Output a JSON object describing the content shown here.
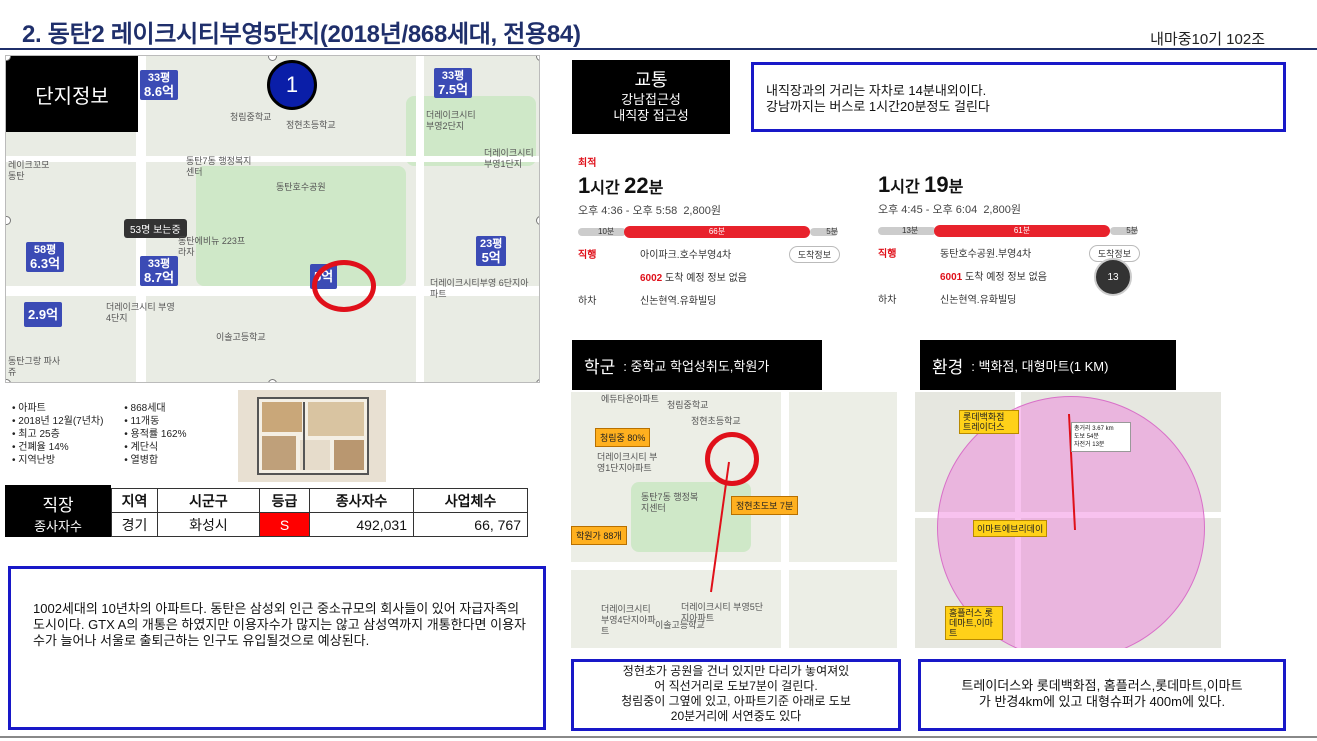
{
  "title": "2. 동탄2 레이크시티부영5단지(2018년/868세대, 전용84)",
  "subtitle": "내마중10기 102조",
  "map": {
    "label": "단지정보",
    "marker_number": "1",
    "viewing_badge": "53명 보는중",
    "prices": [
      {
        "top": "33평",
        "value": "8.6억"
      },
      {
        "top": "33평",
        "value": "7.5억"
      },
      {
        "top": "58평",
        "value": "6.3억"
      },
      {
        "top": "33평",
        "value": "8.7억"
      },
      {
        "top": "23평",
        "value": "5억"
      },
      {
        "top": "",
        "value": "2.9억"
      },
      {
        "top": "",
        "value": "5억"
      }
    ],
    "places": [
      "청림중학교",
      "정현초등학교",
      "동탄7동 행정복지센터",
      "동탄호수공원",
      "더레이크시티 부영2단지",
      "더레이크시티 부영1단지",
      "동탄에비뉴 223프라자",
      "더레이크시티부영 6단지아파트",
      "더레이크시티 부영4단지",
      "이솔고등학교",
      "레이크꼬모 동탄",
      "동탄그랑 파사쥬"
    ]
  },
  "apt_info": {
    "left": [
      "아파트",
      "2018년 12월(7년차)",
      "최고 25층",
      "건폐율 14%",
      "지역난방"
    ],
    "right": [
      "868세대",
      "11개동",
      "용적률 162%",
      "계단식",
      "열병합"
    ]
  },
  "jobs": {
    "label_main": "직장",
    "label_sub": "종사자수",
    "headers": [
      "지역",
      "시군구",
      "등급",
      "종사자수",
      "사업체수"
    ],
    "row": [
      "경기",
      "화성시",
      "S",
      "492,031",
      "66, 767"
    ]
  },
  "summary": "1002세대의 10년차의 아파트다. 동탄은 삼성외 인근 중소규모의 회사들이 있어 자급자족의 도시이다. GTX A의 개통은 하였지만 이용자수가 많지는 않고 삼성역까지 개통한다면 이용자수가 늘어나 서울로 출퇴근하는 인구도 유입될것으로 예상된다.",
  "transport": {
    "label_main": "교통",
    "label_sub1": "강남접근성",
    "label_sub2": "내직장 접근성",
    "text_line1": "내직장과의 거리는 자차로 14분내외이다.",
    "text_line2": "강남까지는 버스로 1시간20분정도 걸린다",
    "routes": [
      {
        "best": "최적",
        "hours": "1",
        "hour_unit": "시간",
        "minutes": "22",
        "minute_unit": "분",
        "times": "오후 4:36 - 오후 5:58",
        "fare": "2,800원",
        "walk1": "10분",
        "ride": "66분",
        "walk2": "5분",
        "board_label": "직행",
        "board_stop": "아이파크.호수부영4차",
        "stop_info": "도착정보",
        "bus_no": "6002",
        "bus_status": "도착 예정 정보 없음",
        "alight_label": "하차",
        "alight_stop": "신논현역.유화빌딩"
      },
      {
        "best": "",
        "hours": "1",
        "hour_unit": "시간",
        "minutes": "19",
        "minute_unit": "분",
        "times": "오후 4:45 - 오후 6:04",
        "fare": "2,800원",
        "walk1": "13분",
        "ride": "61분",
        "walk2": "5분",
        "board_label": "직행",
        "board_stop": "동탄호수공원.부영4차",
        "stop_info": "도착정보",
        "bus_no": "6001",
        "bus_status": "도착 예정 정보 없음",
        "alight_label": "하차",
        "alight_stop": "신논현역.유화빌딩",
        "fab": "13"
      }
    ]
  },
  "school": {
    "label_main": "학군",
    "label_sub": ": 중학교 학업성취도,학원가",
    "tag_rate": "청림중 80%",
    "tag_academy": "학원가 88개",
    "tag_walk": "정현초도보 7분",
    "map_places": [
      "에듀타운아파트",
      "청림중학교",
      "정현초등학교",
      "더레이크시티 부영1단지아파트",
      "동탄7동 행정복지센터",
      "더레이크시티 부영4단지아파트",
      "이솔고등학교",
      "더레이크시티 부영5단지아파트"
    ],
    "text_line1": "정현초가 공원을 건너 있지만 다리가 놓여져있",
    "text_line2": "어 직선거리로 도보7분이 걸린다.",
    "text_line3": "청림중이 그옆에 있고, 아파트기준 아래로 도보",
    "text_line4": "20분거리에 서연중도 있다"
  },
  "env": {
    "label_main": "환경",
    "label_sub": ": 백화점, 대형마트(1 KM)",
    "tag1": "롯데백화점 트레이더스",
    "tag2": "이마트에브리데이",
    "tag3": "홈플러스 롯데마트,이마트",
    "popup": [
      "총거리 3.67 km",
      "도보 54분",
      "자전거 13분"
    ],
    "text_line1": "트레이더스와 롯데백화점, 홈플러스,롯데마트,이마트",
    "text_line2": "가 반경4km에 있고 대형슈퍼가 400m에 있다."
  },
  "colors": {
    "title": "#1f2f6b",
    "accent_blue": "#1818c8",
    "accent_red": "#e0101a",
    "pin": "#3b4bb5"
  }
}
